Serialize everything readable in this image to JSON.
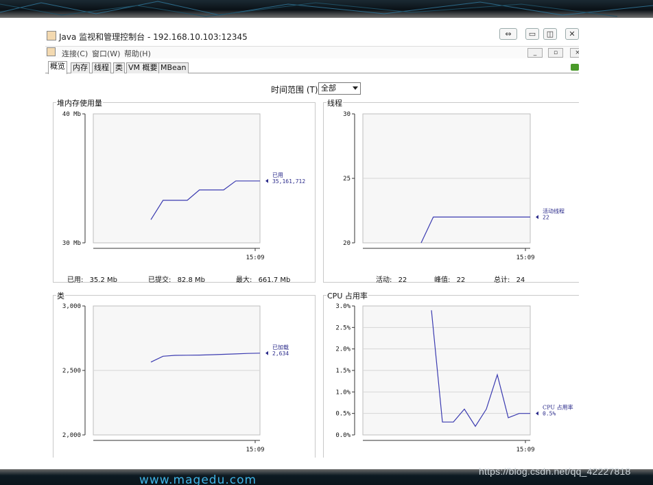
{
  "window": {
    "title": "Java 监视和管理控制台 - 192.168.10.103:12345",
    "controls": [
      "⇔",
      "▭",
      "◫",
      "✕"
    ]
  },
  "menubar": {
    "items": [
      "连接(C)",
      "窗口(W)",
      "帮助(H)"
    ],
    "inner_controls": [
      "_",
      "▫",
      "×"
    ]
  },
  "tabs": [
    "概览",
    "内存",
    "线程",
    "类",
    "VM 概要",
    "MBean"
  ],
  "active_tab": "概览",
  "time_range": {
    "label": "时间范围 (T):",
    "value": "全部"
  },
  "panels": {
    "heap": {
      "title": "堆内存使用量",
      "y_ticks": [
        "40 Mb",
        "30 Mb"
      ],
      "x_tick": "15:09",
      "legend_name": "已用",
      "legend_value": "35,161,712",
      "stats": [
        {
          "label": "已用:",
          "value": "35.2  Mb"
        },
        {
          "label": "已提交:",
          "value": "82.8  Mb"
        },
        {
          "label": "最大:",
          "value": "661.7  Mb"
        }
      ]
    },
    "threads": {
      "title": "线程",
      "y_ticks": [
        "30",
        "25",
        "20"
      ],
      "x_tick": "15:09",
      "legend_name": "活动线程",
      "legend_value": "22",
      "stats": [
        {
          "label": "活动:",
          "value": "22"
        },
        {
          "label": "峰值:",
          "value": "22"
        },
        {
          "label": "总计:",
          "value": "24"
        }
      ]
    },
    "classes": {
      "title": "类",
      "y_ticks": [
        "3,000",
        "2,500",
        "2,000"
      ],
      "x_tick": "15:09",
      "legend_name": "已加载",
      "legend_value": "2,634"
    },
    "cpu": {
      "title": "CPU 占用率",
      "y_ticks": [
        "3.0%",
        "2.5%",
        "2.0%",
        "1.5%",
        "1.0%",
        "0.5%",
        "0.0%"
      ],
      "x_tick": "15:09",
      "legend_name": "CPU 占用率",
      "legend_value": "0.5%"
    }
  },
  "chart_data": [
    {
      "type": "line",
      "title": "堆内存使用量",
      "ylabel": "Mb",
      "ylim": [
        30,
        40
      ],
      "x_end_label": "15:09",
      "series": [
        {
          "name": "已用",
          "x": [
            0,
            1,
            2,
            3,
            4,
            5,
            6,
            7,
            8,
            9
          ],
          "y": [
            31.8,
            33.3,
            33.3,
            33.3,
            34.1,
            34.1,
            34.1,
            34.8,
            34.8,
            34.8
          ]
        }
      ]
    },
    {
      "type": "line",
      "title": "线程",
      "ylim": [
        20,
        30
      ],
      "x_end_label": "15:09",
      "series": [
        {
          "name": "活动线程",
          "x": [
            0,
            1,
            2,
            3,
            4,
            5,
            6,
            7,
            8,
            9
          ],
          "y": [
            20,
            22,
            22,
            22,
            22,
            22,
            22,
            22,
            22,
            22
          ]
        }
      ]
    },
    {
      "type": "line",
      "title": "类",
      "ylim": [
        2000,
        3000
      ],
      "x_end_label": "15:09",
      "series": [
        {
          "name": "已加载",
          "x": [
            0,
            1,
            2,
            3,
            4,
            5,
            6,
            7,
            8,
            9
          ],
          "y": [
            2565,
            2610,
            2617,
            2618,
            2619,
            2622,
            2625,
            2628,
            2632,
            2634
          ]
        }
      ]
    },
    {
      "type": "line",
      "title": "CPU 占用率",
      "ylabel": "%",
      "ylim": [
        0.0,
        3.0
      ],
      "x_end_label": "15:09",
      "series": [
        {
          "name": "CPU 占用率",
          "x": [
            0,
            1,
            2,
            3,
            4,
            5,
            6,
            7,
            8,
            9
          ],
          "y": [
            2.9,
            0.3,
            0.3,
            0.6,
            0.2,
            0.6,
            1.4,
            0.4,
            0.5,
            0.5
          ]
        }
      ]
    }
  ],
  "page": {
    "brand": "www.magedu.com",
    "watermark": "https://blog.csdn.net/qq_42227818"
  }
}
